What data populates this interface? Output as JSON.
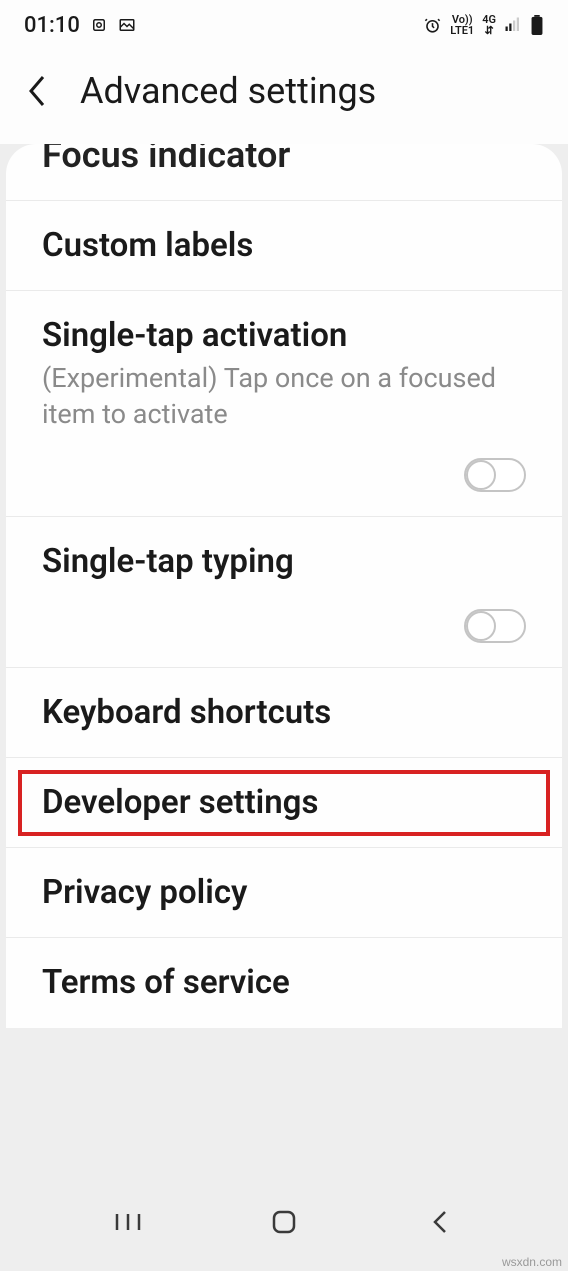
{
  "statusbar": {
    "time": "01:10",
    "network_label_top": "Vo))",
    "network_label_bottom": "LTE1",
    "signal_label": "4G"
  },
  "header": {
    "title": "Advanced settings"
  },
  "peek": {
    "title": "Focus indicator"
  },
  "items": [
    {
      "title": "Custom labels"
    },
    {
      "title": "Single-tap activation",
      "subtitle": "(Experimental) Tap once on a focused item to activate",
      "toggle": false
    },
    {
      "title": "Single-tap typing",
      "toggle": false
    },
    {
      "title": "Keyboard shortcuts"
    },
    {
      "title": "Developer settings",
      "highlight": true
    },
    {
      "title": "Privacy policy"
    },
    {
      "title": "Terms of service"
    }
  ],
  "watermark": "wsxdn.com"
}
